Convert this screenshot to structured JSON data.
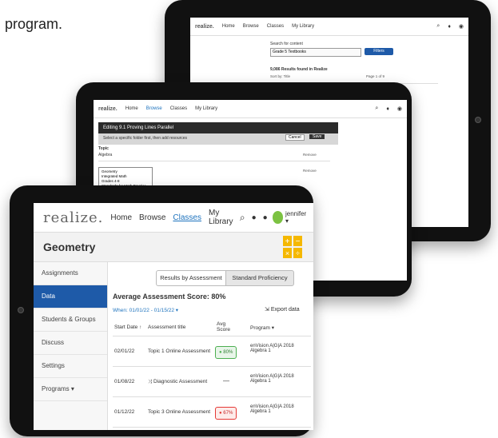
{
  "caption": "program.",
  "back_screen": {
    "logo": "realize.",
    "nav": [
      "Home",
      "Browse",
      "Classes",
      "My Library"
    ],
    "search_label": "Search for content",
    "search_value": "Grade 5 Textbooks",
    "filters_button": "Filters",
    "results_label": "9,086 Results found in Realize",
    "sort_label": "Sort by: Title",
    "page_label": "Page 1 of 9"
  },
  "mid_screen": {
    "logo": "realize.",
    "nav": [
      "Home",
      "Browse",
      "Classes",
      "My Library"
    ],
    "modal_title": "Editing 9.1 Proving Lines Parallel",
    "modal_note": "Select a specific folder first, then add resources",
    "cancel_label": "Cancel",
    "save_label": "Save",
    "field_label": "Topic",
    "field_value": "Algebra",
    "remove_label": "Remove",
    "dropdown_items": [
      "Geometry",
      "Integrated Math",
      "Grades 4-8",
      "Standards for Math Practice"
    ]
  },
  "front_screen": {
    "logo": "realize.",
    "nav": [
      {
        "label": "Home",
        "active": false
      },
      {
        "label": "Browse",
        "active": false
      },
      {
        "label": "Classes",
        "active": true
      },
      {
        "label": "My Library",
        "active": false
      }
    ],
    "user_label": "jennifer",
    "class_title": "Geometry",
    "sidebar": [
      {
        "label": "Assignments",
        "active": false
      },
      {
        "label": "Data",
        "active": true
      },
      {
        "label": "Students & Groups",
        "active": false
      },
      {
        "label": "Discuss",
        "active": false
      },
      {
        "label": "Settings",
        "active": false
      },
      {
        "label": "Programs ▾",
        "active": false
      }
    ],
    "tabs": [
      {
        "label": "Results by Assessment",
        "active": true
      },
      {
        "label": "Standard Proficiency",
        "active": false
      }
    ],
    "avg_label": "Average Assessment Score: 80%",
    "when_label": "When: 01/01/22 - 01/15/22 ▾",
    "export_label": "Export data",
    "table_headers": [
      "Start Date ↑",
      "Assessment title",
      "Avg Score",
      "Program ▾"
    ],
    "rows": [
      {
        "date": "02/01/22",
        "title": "Topic 1 Online Assessment",
        "score": "80%",
        "score_color": "#4caf50",
        "program": "enVision A|G|A 2018 Algebra 1"
      },
      {
        "date": "01/08/22",
        "title": "Diagnostic Assessment",
        "score": "—",
        "score_color": "",
        "program": "enVision A|G|A 2018 Algebra 1"
      },
      {
        "date": "01/12/22",
        "title": "Topic 3 Online Assessment",
        "score": "67%",
        "score_color": "#e53935",
        "program": "enVision A|G|A 2018 Algebra 1"
      }
    ]
  }
}
